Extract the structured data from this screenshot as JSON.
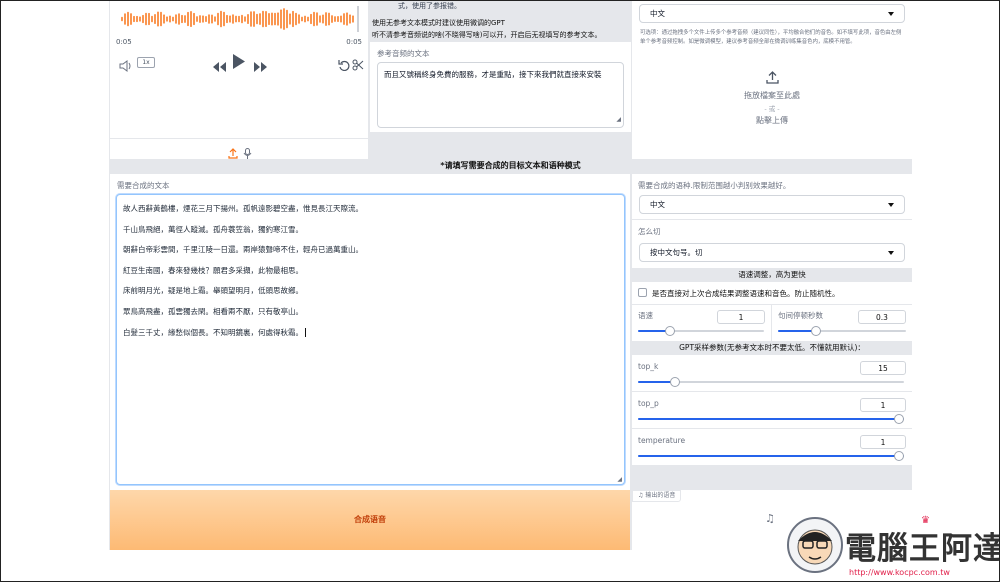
{
  "audio": {
    "time_start": "0:05",
    "time_end": "0:05",
    "speed": "1x"
  },
  "middle": {
    "hint_top": "式，使用了参报错。",
    "hint_line1": "使用无参考文本模式时建议使用微调的GPT",
    "hint_line2": "听不清参考音频说的啥(不晓得写啥)可以开，开启后无视填写的参考文本。",
    "ref_text_label": "参考音频的文本",
    "ref_text_value": "而且又號稱終身免費的服務，才是重點，接下來我們就直接來安裝"
  },
  "right_top": {
    "language_value": "中文",
    "note": "可选项：通过拖拽多个文件上传多个参考音频（建议同性），平均融合他们的音色。如不填写此项，音色由左侧单个参考音频控制。如是微调模型，建议参考音频全部在微调训练集音色内，底模不用管。",
    "drop_line1": "拖放檔案至此處",
    "drop_or": "- 或 -",
    "drop_line2": "點擊上傳"
  },
  "banner": "*请填写需要合成的目标文本和语种模式",
  "synth": {
    "label": "需要合成的文本",
    "lines": [
      "故人西辭黃鶴樓，煙花三月下揚州。孤帆遠影碧空盡，惟見長江天際流。",
      "千山鳥飛絕，萬徑人蹤滅。孤舟蓑笠翁，獨釣寒江雪。",
      "朝辭白帝彩雲間，千里江陵一日還。兩岸猿聲啼不住，輕舟已過萬重山。",
      "紅豆生南國，春來發幾枝？願君多采擷，此物最相思。",
      "床前明月光，疑是地上霜。舉頭望明月，低頭思故鄉。",
      "眾鳥高飛盡，孤雲獨去閑。相看兩不厭，只有敬亭山。",
      "白髮三千丈，緣愁似個長。不知明鏡裏，何處得秋霜。"
    ],
    "button": "合成语音"
  },
  "settings": {
    "lang_label": "需要合成的语种.限制范围越小判别效果越好。",
    "lang_value": "中文",
    "cut_label": "怎么切",
    "cut_value": "按中文句号。切",
    "speed_section": "语速调整，高为更快",
    "checkbox_label": "是否直接对上次合成结果调整语速和音色。防止随机性。",
    "speed_label": "语速",
    "speed_value": "1",
    "speed_fraction": 0.25,
    "pause_label": "句间停顿秒数",
    "pause_value": "0.3",
    "pause_fraction": 0.3,
    "gpt_section": "GPT采样参数(无参考文本时不要太低。不懂就用默认)：",
    "topk_label": "top_k",
    "topk_value": "15",
    "topk_fraction": 0.14,
    "topp_label": "top_p",
    "topp_value": "1",
    "topp_fraction": 1.0,
    "temp_label": "temperature",
    "temp_value": "1",
    "temp_fraction": 1.0,
    "output_label": "输出的语音"
  },
  "watermark": {
    "title": "電腦王阿達",
    "url": "http://www.kocpc.com.tw"
  },
  "colors": {
    "accent_orange": "#f97316",
    "slider_blue": "#2563eb",
    "button_grad_top": "#fed7aa",
    "button_grad_bottom": "#fdba74"
  }
}
